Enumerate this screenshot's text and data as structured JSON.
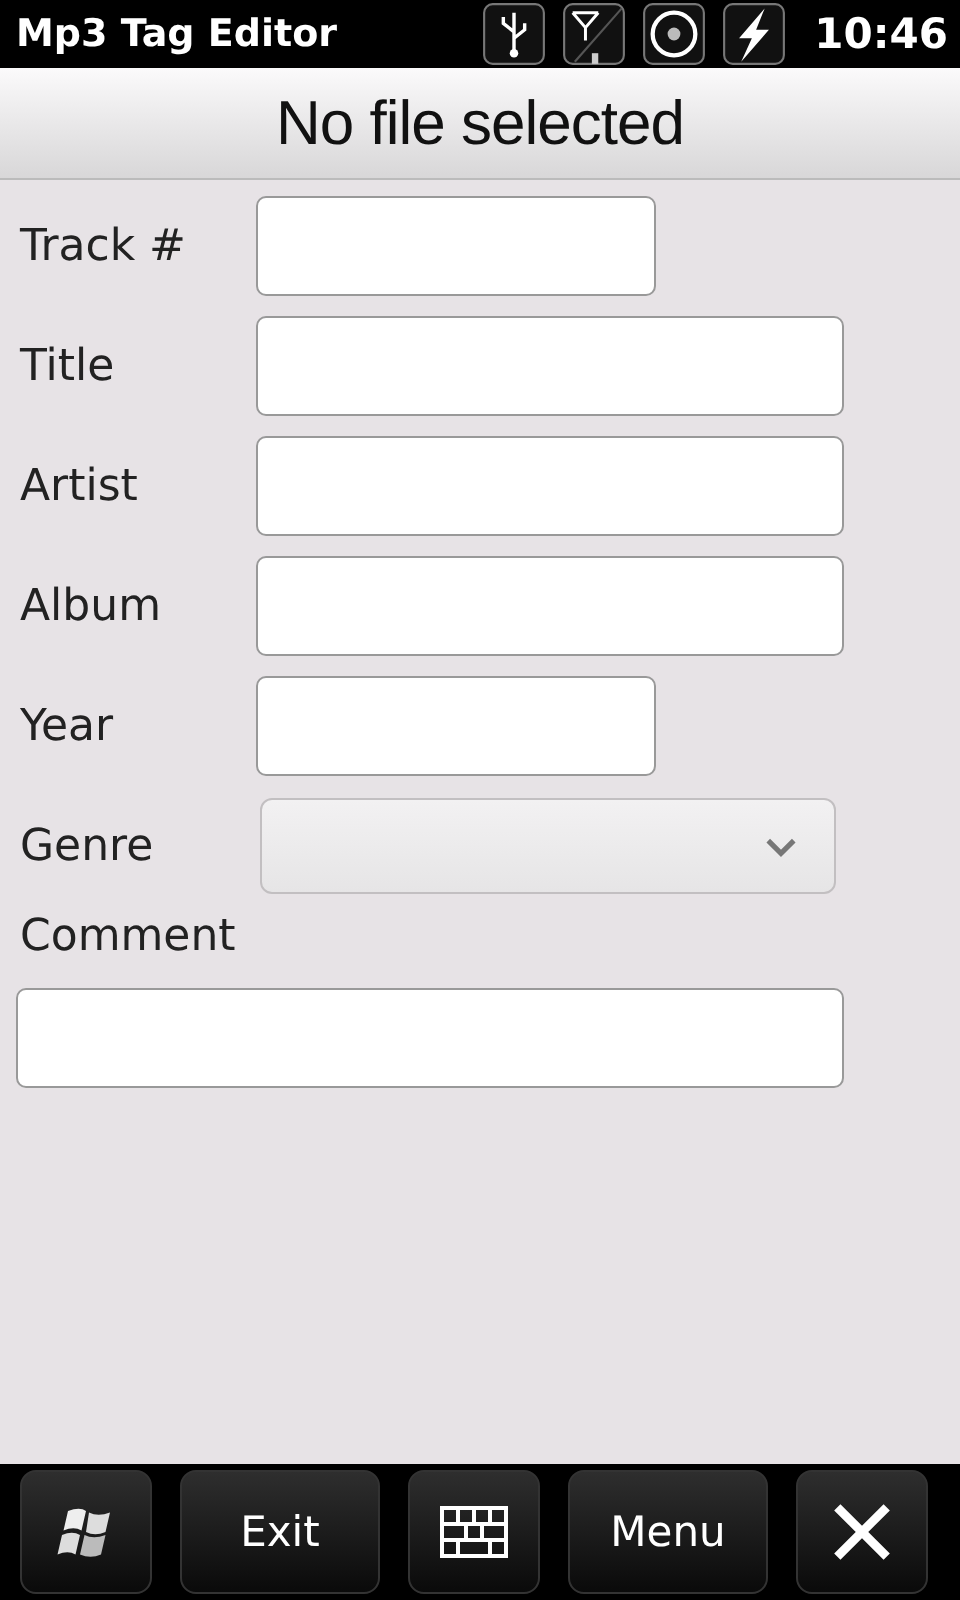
{
  "status_bar": {
    "app_title": "Mp3 Tag Editor",
    "time": "10:46"
  },
  "header": {
    "title": "No file selected"
  },
  "fields": [
    {
      "label": "Track #",
      "kind": "short"
    },
    {
      "label": "Title",
      "kind": "long"
    },
    {
      "label": "Artist",
      "kind": "long"
    },
    {
      "label": "Album",
      "kind": "long"
    },
    {
      "label": "Year",
      "kind": "short"
    },
    {
      "label": "Genre",
      "kind": "select",
      "disabled": true
    },
    {
      "label": "Comment",
      "kind": "wide"
    }
  ],
  "softkeys": [
    {
      "kind": "start"
    },
    {
      "kind": "text",
      "label": "Exit"
    },
    {
      "kind": "keyboard"
    },
    {
      "kind": "text",
      "label": "Menu"
    },
    {
      "kind": "close"
    }
  ]
}
